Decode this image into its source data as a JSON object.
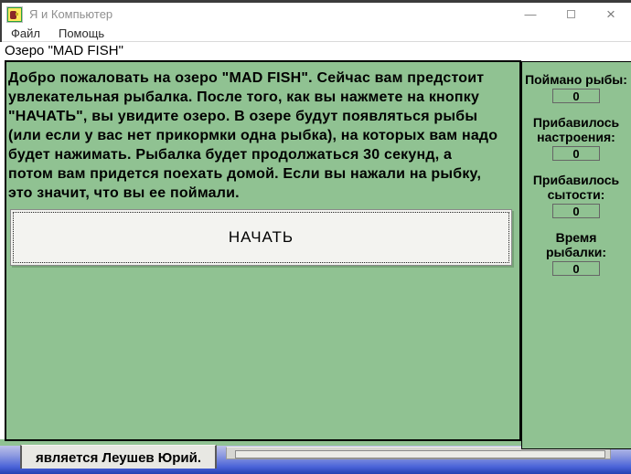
{
  "window": {
    "title": "Я и Компьютер"
  },
  "titlebar_icons": {
    "minimize": "—",
    "close": "×"
  },
  "menu": {
    "file": "Файл",
    "help": "Помощь"
  },
  "caption": "Озеро \"MAD FISH\"",
  "main": {
    "lines": [
      "Добро пожаловать на озеро \"MAD FISH\". Сейчас вам предстоит",
      "увлекательная рыбалка. После того, как вы нажмете на кнопку",
      "\"НАЧАТЬ\", вы увидите озеро. В озере будут появляться рыбы",
      "(или если у вас нет прикормки одна рыбка), на которых вам надо",
      "будет нажимать. Рыбалка будет продолжаться 30 секунд, а",
      "потом вам придется поехать домой. Если вы нажали на рыбку,",
      "это значит, что вы ее поймали."
    ],
    "button": "НАЧАТЬ"
  },
  "stats": {
    "counters": [
      {
        "label": "Поймано рыбы:",
        "value": "0"
      },
      {
        "label": "Прибавилось настроения:",
        "value": "0"
      },
      {
        "label": "Прибавилось сытости:",
        "value": "0"
      },
      {
        "label": "Время рыбалки:",
        "value": "0"
      }
    ]
  },
  "footer": {
    "author": "является Леушев Юрий."
  },
  "colors": {
    "panel_green": "#90c292",
    "footer_blue_top": "#bcc0e8",
    "footer_blue_bottom": "#2440b2"
  }
}
